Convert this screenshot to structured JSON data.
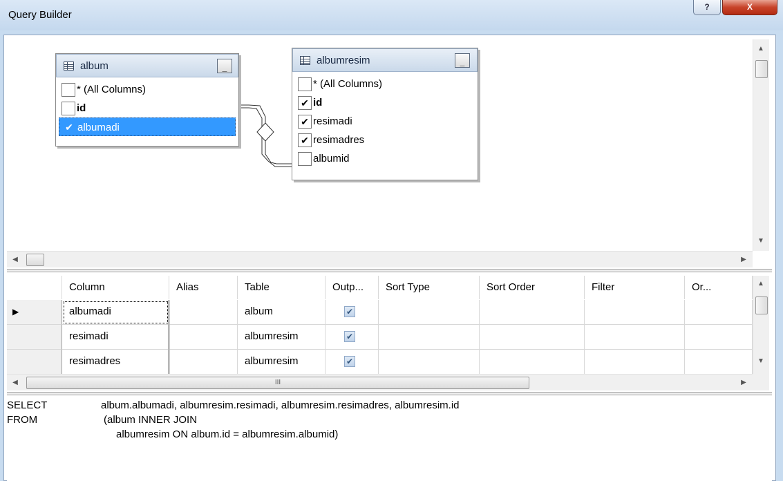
{
  "window": {
    "title": "Query Builder",
    "help_label": "?",
    "close_label": "X"
  },
  "diagram": {
    "tables": [
      {
        "name": "album",
        "minimize_label": "_",
        "columns": [
          {
            "label": "* (All Columns)",
            "checked": false
          },
          {
            "label": "id",
            "checked": false
          },
          {
            "label": "albumadi",
            "checked": true,
            "selected": true
          }
        ]
      },
      {
        "name": "albumresim",
        "minimize_label": "_",
        "columns": [
          {
            "label": "* (All Columns)",
            "checked": false
          },
          {
            "label": "id",
            "checked": true
          },
          {
            "label": "resimadi",
            "checked": true
          },
          {
            "label": "resimadres",
            "checked": true
          },
          {
            "label": "albumid",
            "checked": false
          }
        ]
      }
    ],
    "check_glyph": "✔",
    "arrow_up": "▲",
    "arrow_down": "▼",
    "arrow_left": "◀",
    "arrow_right": "▶"
  },
  "grid": {
    "headers": [
      "Column",
      "Alias",
      "Table",
      "Outp...",
      "Sort Type",
      "Sort Order",
      "Filter",
      "Or..."
    ],
    "current_row_marker": "▶",
    "output_glyph": "✔",
    "rows": [
      {
        "column": "albumadi",
        "alias": "",
        "table": "album",
        "output": true,
        "sort_type": "",
        "sort_order": "",
        "filter": "",
        "or": ""
      },
      {
        "column": "resimadi",
        "alias": "",
        "table": "albumresim",
        "output": true,
        "sort_type": "",
        "sort_order": "",
        "filter": "",
        "or": ""
      },
      {
        "column": "resimadres",
        "alias": "",
        "table": "albumresim",
        "output": true,
        "sort_type": "",
        "sort_order": "",
        "filter": "",
        "or": ""
      }
    ],
    "hscroll_grip": "III"
  },
  "sql": {
    "lines": [
      {
        "keyword": "SELECT",
        "text": "album.albumadi, albumresim.resimadi, albumresim.resimadres, albumresim.id"
      },
      {
        "keyword": "FROM",
        "text": "(album INNER JOIN"
      },
      {
        "keyword": "",
        "text": "albumresim ON album.id = albumresim.albumid)"
      }
    ]
  }
}
